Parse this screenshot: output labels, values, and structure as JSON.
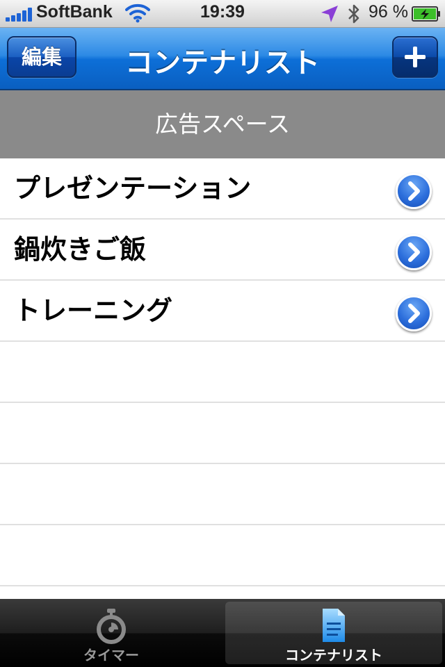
{
  "status_bar": {
    "carrier": "SoftBank",
    "time": "19:39",
    "battery_percent": "96 %"
  },
  "nav_bar": {
    "title": "コンテナリスト",
    "edit_label": "編集",
    "add_icon": "plus-icon"
  },
  "ad_banner": {
    "text": "広告スペース"
  },
  "list": {
    "items": [
      {
        "label": "プレゼンテーション"
      },
      {
        "label": "鍋炊きご飯"
      },
      {
        "label": "トレーニング"
      }
    ]
  },
  "tab_bar": {
    "tabs": [
      {
        "label": "タイマー",
        "icon": "stopwatch-icon",
        "selected": false
      },
      {
        "label": "コンテナリスト",
        "icon": "document-icon",
        "selected": true
      }
    ]
  },
  "colors": {
    "nav_blue": "#2d8ae5",
    "ad_gray": "#8a8a8a",
    "tabbar_black": "#000000",
    "accent_blue": "#2d6fdc"
  }
}
